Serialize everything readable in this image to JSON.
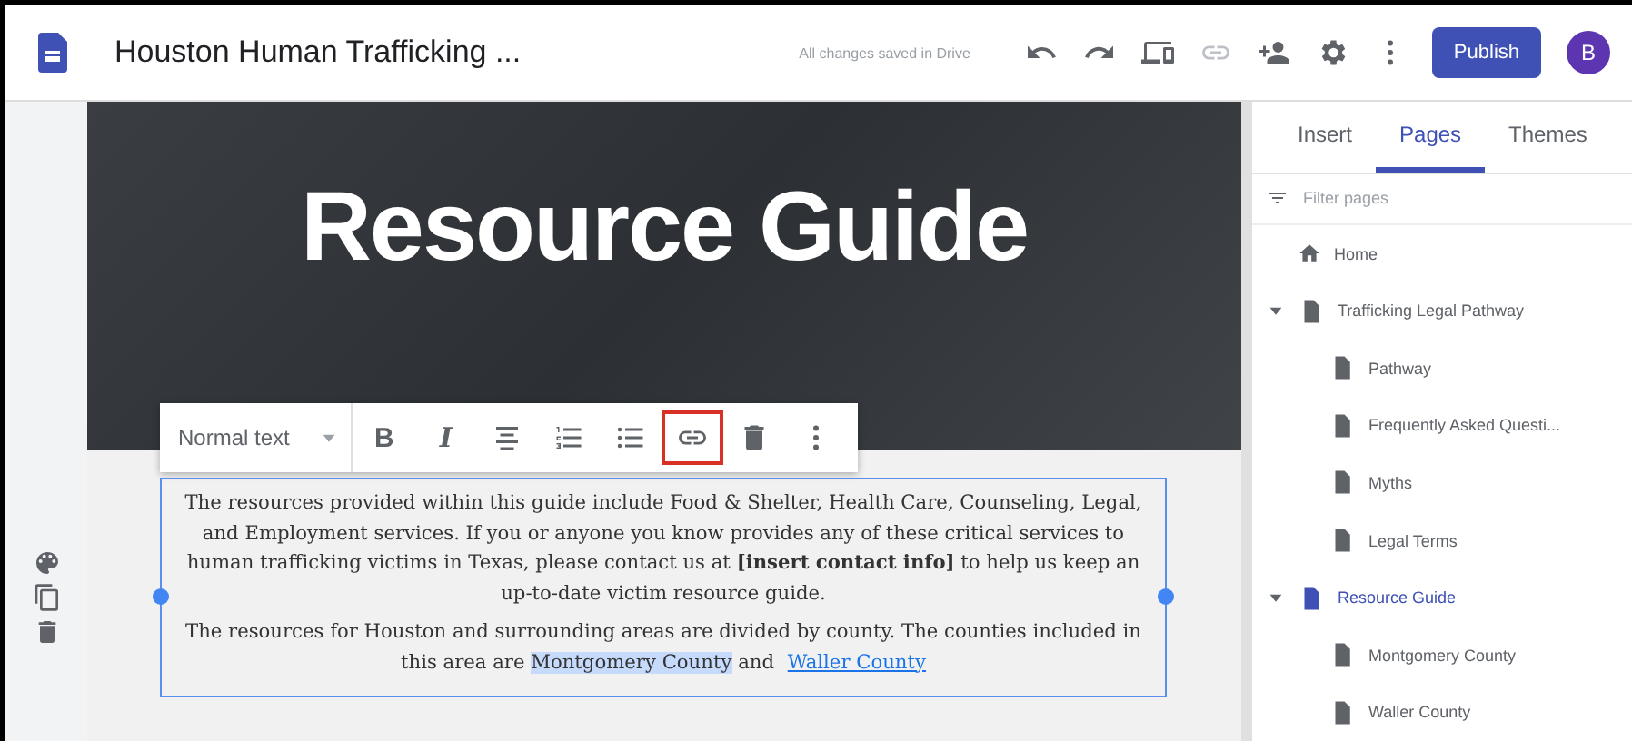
{
  "top_bar": {
    "title": "Houston Human Trafficking ...",
    "save_status": "All changes saved in Drive",
    "publish": "Publish",
    "avatar": "B"
  },
  "header": {
    "title": "Resource Guide"
  },
  "toolbar": {
    "style": "Normal text",
    "tools": [
      {
        "kind": "bold",
        "label": "B",
        "selected": false
      },
      {
        "kind": "italic",
        "label": "I",
        "selected": false
      },
      {
        "kind": "align",
        "selected": false
      },
      {
        "kind": "numbered",
        "selected": false
      },
      {
        "kind": "bulleted",
        "selected": false
      },
      {
        "kind": "link",
        "selected": true
      },
      {
        "kind": "delete",
        "selected": false
      },
      {
        "kind": "more",
        "selected": false
      }
    ]
  },
  "body": {
    "paragraph_1": "The resources provided within this guide include Food & Shelter, Health Care, Counseling, Legal, and Employment services. If you or anyone you know provides any of these critical services to human trafficking victims in Texas, please contact us at **[insert contact info]** to help us keep an up-to-date victim resource guide.",
    "paragraph_2": {
      "text_before": "The resources for Houston and surrounding areas are divided by county. The counties included in this area are ",
      "selected_text": "Montgomery County",
      "text_between": " and ",
      "link": "Waller County"
    }
  },
  "panel": {
    "tabs": [
      {
        "label": "Insert",
        "selected": false
      },
      {
        "label": "Pages",
        "selected": true
      },
      {
        "label": "Themes",
        "selected": false
      }
    ],
    "filter": {
      "placeholder": "Filter pages"
    },
    "pages": [
      {
        "label": "Home",
        "kind": "home",
        "selected": false
      },
      {
        "label": "Trafficking Legal Pathway",
        "kind": "page",
        "selected": false,
        "expanded": true,
        "children": [
          {
            "label": "Pathway",
            "kind": "page",
            "selected": false
          },
          {
            "label": "Frequently Asked Questi...",
            "kind": "page",
            "selected": false
          },
          {
            "label": "Myths",
            "kind": "page",
            "selected": false
          },
          {
            "label": "Legal Terms",
            "kind": "page",
            "selected": false
          }
        ]
      },
      {
        "label": "Resource Guide",
        "kind": "page",
        "selected": true,
        "expanded": true,
        "children": [
          {
            "label": "Montgomery County",
            "kind": "page",
            "selected": false
          },
          {
            "label": "Waller County",
            "kind": "page",
            "selected": false
          }
        ]
      }
    ]
  }
}
